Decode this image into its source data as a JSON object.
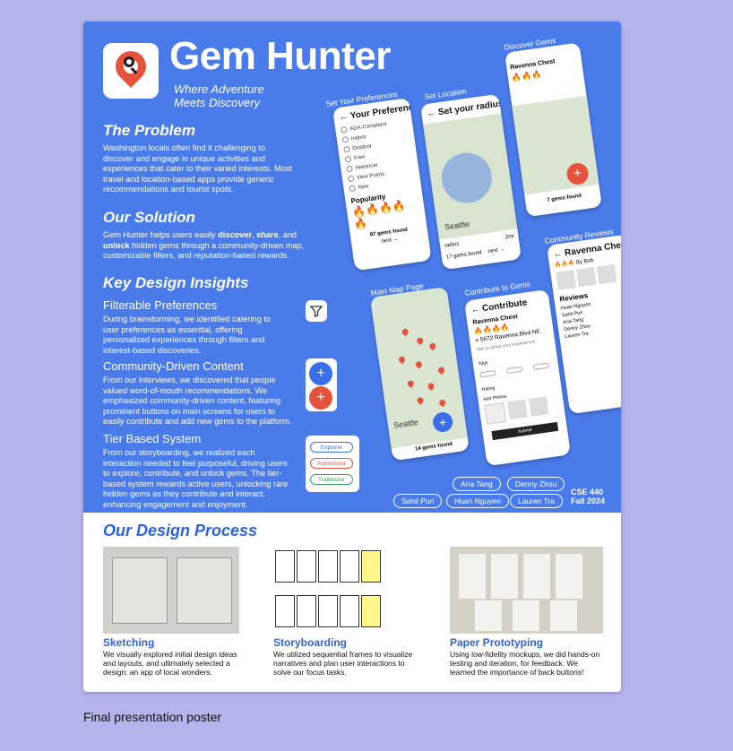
{
  "poster": {
    "title": "Gem Hunter",
    "tagline_line1": "Where Adventure",
    "tagline_line2": "Meets Discovery",
    "problem": {
      "heading": "The Problem",
      "body": "Washington locals often find it challenging to discover and engage in unique activities and experiences that cater to their varied interests. Most travel and location-based apps provide generic recommendations and tourist spots."
    },
    "solution": {
      "heading": "Our Solution",
      "body_pre": "Gem Hunter helps users easily ",
      "kw1": "discover",
      "sep1": ", ",
      "kw2": "share",
      "sep2": ", and ",
      "kw3": "unlock",
      "body_post": " hidden gems through a community-driven map, customizable filters, and reputation-based rewards."
    },
    "insights": {
      "heading": "Key Design Insights",
      "items": [
        {
          "title": "Filterable Preferences",
          "body": "During brainstorming, we identified catering to user preferences as essential, offering personalized experiences through filters and interest-based discoveries."
        },
        {
          "title": "Community-Driven Content",
          "body": "From our interviews, we discovered that people valued word-of-mouth recommendations. We emphasized community-driven content, featuring prominent buttons on main screens for users to easily contribute and add new gems to the platform."
        },
        {
          "title": "Tier Based System",
          "body": "From our storyboarding, we realized each interaction needed to feel purposeful, driving users to explore, contribute, and unlock gems. The tier-based system rewards active users, unlocking rare hidden gems as they contribute and interact, enhancing engagement and enjoyment."
        }
      ]
    },
    "tiers": [
      "Explorer",
      "Adventurer",
      "Trailblazer"
    ],
    "screens": {
      "preferences": {
        "label": "Set Your Preferences",
        "title": "← Your Preferences",
        "filters": [
          "ADA-Compliant",
          "Indoor",
          "Outdoor",
          "Free",
          "Historical",
          "View Points",
          "New"
        ],
        "popularity": "Popularity",
        "found": "87 gems found",
        "next": "next →"
      },
      "location": {
        "label": "Set Location",
        "title": "← Set your radius",
        "city": "Seattle",
        "radius": "radius",
        "radius_value": "2mi",
        "found": "17 gems found",
        "next": "next →"
      },
      "discover": {
        "label": "Discover Gems",
        "place": "Ravenna Chest",
        "found": "7 gems found"
      },
      "reviews": {
        "label": "Community Reviews",
        "title": "← Ravenna Chest",
        "by": "By Bob",
        "reviews": "Reviews",
        "names": [
          "Huan Nguyen",
          "Sahil Puri",
          "Aria Tang",
          "Denny Zhou",
          "Lauren Tra"
        ]
      },
      "map": {
        "label": "Main Map Page",
        "city": "Seattle",
        "found": "14 gems found"
      },
      "contribute": {
        "label": "Contribute to Gems",
        "title": "← Contribute",
        "place": "Ravenna Chest",
        "address": "5672 Ravenna Blvd NE",
        "prompt": "Tell us about your experience!",
        "tags": "Tags",
        "rating": "Rating",
        "photos": "Add Photos",
        "submit": "Submit"
      }
    },
    "team": [
      "Aria Tang",
      "Denny Zhou",
      "Sahil Puri",
      "Huan Nguyen",
      "Lauren Tra"
    ],
    "course_line1": "CSE 440",
    "course_line2": "Fall 2024",
    "process": {
      "heading": "Our Design Process",
      "steps": [
        {
          "title": "Sketching",
          "body": "We visually explored initial design ideas and layouts, and ultimately selected a design: an app of local wonders."
        },
        {
          "title": "Storyboarding",
          "body": "We utilized sequential frames to visualize narratives and plan user interactions to solve our focus tasks."
        },
        {
          "title": "Paper Prototyping",
          "body": "Using low-fidelity mockups, we did hands-on testing and iteration, for feedback. We learned the importance of back buttons!"
        }
      ]
    }
  },
  "caption": "Final presentation poster",
  "colors": {
    "page_bg": "#b3b4ec",
    "poster_blue": "#4a7bea",
    "accent_red": "#e5533d",
    "process_blue": "#2f63d6"
  }
}
